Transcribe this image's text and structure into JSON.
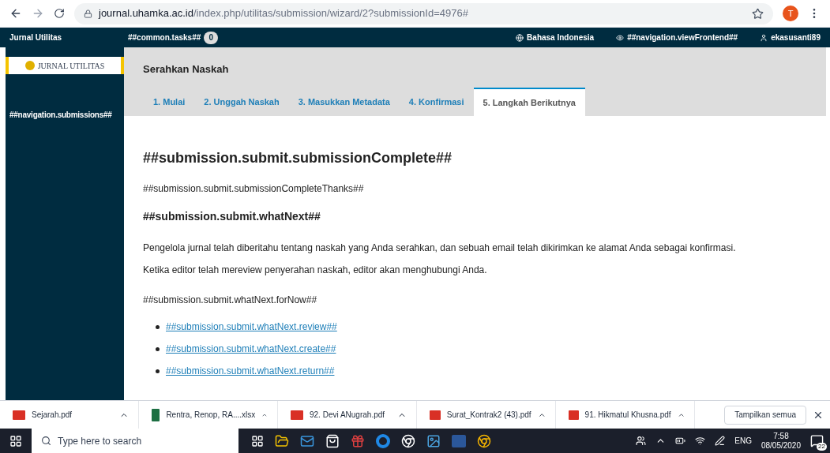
{
  "browser": {
    "url_host": "journal.uhamka.ac.id",
    "url_path": "/index.php/utilitas/submission/wizard/2?submissionId=4976#",
    "profile_initial": "T"
  },
  "header": {
    "journal": "Jurnal Utilitas",
    "tasks_label": "##common.tasks##",
    "tasks_count": "0",
    "language": "Bahasa Indonesia",
    "view_frontend": "##navigation.viewFrontend##",
    "user": "ekasusanti89"
  },
  "sidebar": {
    "logo_text": "JURNAL UTILITAS",
    "items": [
      {
        "label": "##navigation.submissions##",
        "selected": false
      }
    ]
  },
  "page": {
    "title": "Serahkan Naskah",
    "tabs": [
      {
        "label": "1. Mulai",
        "selected": false
      },
      {
        "label": "2. Unggah Naskah",
        "selected": false
      },
      {
        "label": "3. Masukkan Metadata",
        "selected": false
      },
      {
        "label": "4. Konfirmasi",
        "selected": false
      },
      {
        "label": "5. Langkah Berikutnya",
        "selected": true
      }
    ],
    "heading": "##submission.submit.submissionComplete##",
    "thanks": "##submission.submit.submissionCompleteThanks##",
    "subheading": "##submission.submit.whatNext##",
    "paragraphs": [
      "Pengelola jurnal telah diberitahu tentang naskah yang Anda serahkan, dan sebuah email telah dikirimkan ke alamat Anda sebagai konfirmasi.",
      "Ketika editor telah mereview penyerahan naskah, editor akan menghubungi Anda."
    ],
    "for_now": "##submission.submit.whatNext.forNow##",
    "links": [
      "##submission.submit.whatNext.review##",
      "##submission.submit.whatNext.create##",
      "##submission.submit.whatNext.return##"
    ]
  },
  "downloads": {
    "items": [
      {
        "name": "Sejarah.pdf",
        "kind": "pdf"
      },
      {
        "name": "Rentra, Renop, RA....xlsx",
        "kind": "xlsx"
      },
      {
        "name": "92. Devi ANugrah.pdf",
        "kind": "pdf"
      },
      {
        "name": "Surat_Kontrak2 (43).pdf",
        "kind": "pdf"
      },
      {
        "name": "91. Hikmatul Khusna.pdf",
        "kind": "pdf"
      }
    ],
    "show_all": "Tampilkan semua"
  },
  "taskbar": {
    "search_placeholder": "Type here to search",
    "language": "ENG",
    "time": "7:58",
    "date": "08/05/2020",
    "notifications": "22"
  }
}
